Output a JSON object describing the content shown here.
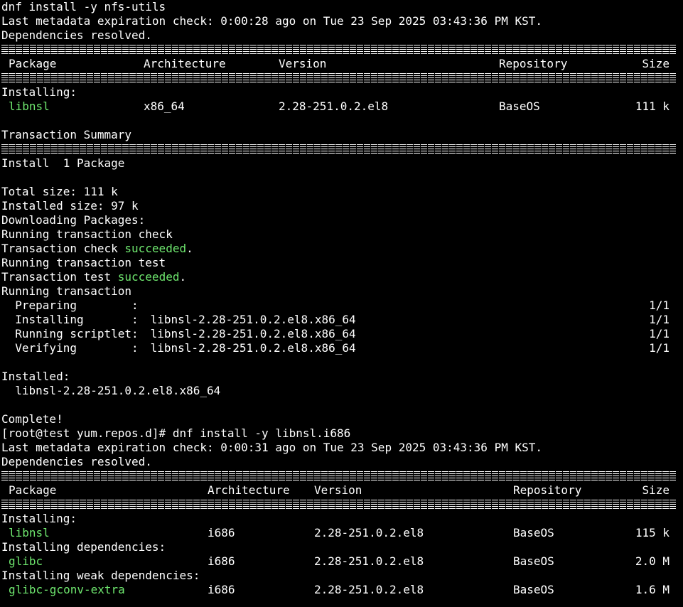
{
  "section1": {
    "cmd": "dnf install -y nfs-utils",
    "metadata": "Last metadata expiration check: 0:00:28 ago on Tue 23 Sep 2025 03:43:36 PM KST.",
    "deps_resolved": "Dependencies resolved.",
    "headers": {
      "package": "Package",
      "arch": "Architecture",
      "version": "Version",
      "repo": "Repository",
      "size": "Size"
    },
    "installing_label": "Installing:",
    "pkg": {
      "name": "libnsl",
      "arch": "x86_64",
      "version": "2.28-251.0.2.el8",
      "repo": "BaseOS",
      "size": "111 k"
    },
    "summary_title": "Transaction Summary",
    "install_count": "Install  1 Package",
    "total_size": "Total size: 111 k",
    "installed_size": "Installed size: 97 k",
    "downloading": "Downloading Packages:",
    "running_check": "Running transaction check",
    "check_prefix": "Transaction check ",
    "check_status": "succeeded",
    "check_suffix": ".",
    "running_test": "Running transaction test",
    "test_prefix": "Transaction test ",
    "test_status": "succeeded",
    "test_suffix": ".",
    "running_tx": "Running transaction",
    "steps": [
      {
        "label": "  Preparing        :",
        "pkg": "",
        "count": "1/1"
      },
      {
        "label": "  Installing       :",
        "pkg": " libnsl-2.28-251.0.2.el8.x86_64",
        "count": "1/1"
      },
      {
        "label": "  Running scriptlet:",
        "pkg": " libnsl-2.28-251.0.2.el8.x86_64",
        "count": "1/1"
      },
      {
        "label": "  Verifying        :",
        "pkg": " libnsl-2.28-251.0.2.el8.x86_64",
        "count": "1/1"
      }
    ],
    "installed_label": "Installed:",
    "installed_pkg": "  libnsl-2.28-251.0.2.el8.x86_64",
    "complete": "Complete!"
  },
  "section2": {
    "prompt": "[root@test yum.repos.d]# ",
    "cmd": "dnf install -y libnsl.i686",
    "metadata": "Last metadata expiration check: 0:00:31 ago on Tue 23 Sep 2025 03:43:36 PM KST.",
    "deps_resolved": "Dependencies resolved.",
    "headers": {
      "package": "Package",
      "arch": "Architecture",
      "version": "Version",
      "repo": "Repository",
      "size": "Size"
    },
    "installing_label": "Installing:",
    "pkg1": {
      "name": "libnsl",
      "arch": "i686",
      "version": "2.28-251.0.2.el8",
      "repo": "BaseOS",
      "size": "115 k"
    },
    "deps_label": "Installing dependencies:",
    "pkg2": {
      "name": "glibc",
      "arch": "i686",
      "version": "2.28-251.0.2.el8",
      "repo": "BaseOS",
      "size": "2.0 M"
    },
    "weak_label": "Installing weak dependencies:",
    "pkg3": {
      "name": "glibc-gconv-extra",
      "arch": "i686",
      "version": "2.28-251.0.2.el8",
      "repo": "BaseOS",
      "size": "1.6 M"
    }
  },
  "colors": {
    "background": "#000000",
    "text": "#ffffff",
    "accent_green": "#6ee66e"
  }
}
